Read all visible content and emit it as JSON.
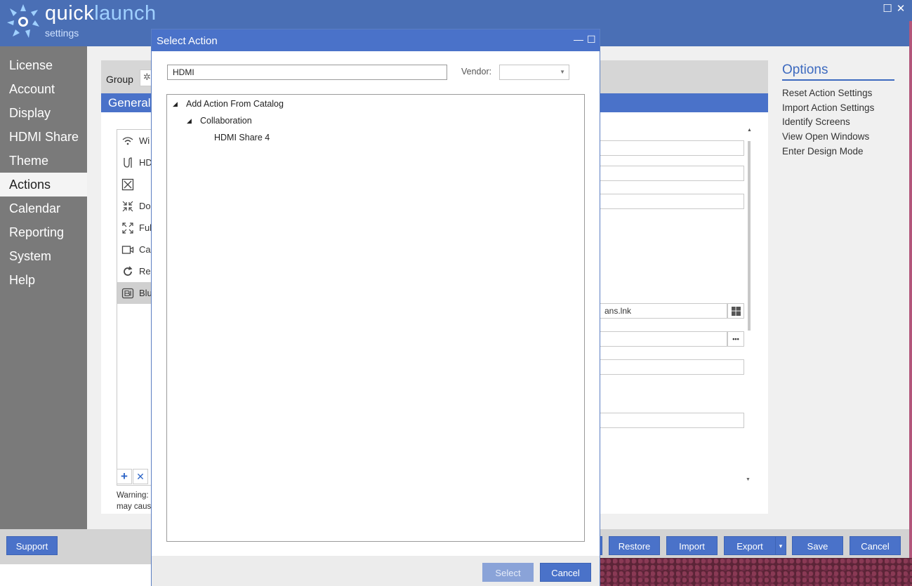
{
  "app": {
    "logo_quick": "quick",
    "logo_launch": "launch",
    "logo_settings": "settings",
    "maximize_glyph": "☐",
    "close_glyph": "✕"
  },
  "sidebar": {
    "items": [
      {
        "label": "License"
      },
      {
        "label": "Account"
      },
      {
        "label": "Display"
      },
      {
        "label": "HDMI Share"
      },
      {
        "label": "Theme"
      },
      {
        "label": "Actions",
        "active": true
      },
      {
        "label": "Calendar"
      },
      {
        "label": "Reporting"
      },
      {
        "label": "System"
      },
      {
        "label": "Help"
      }
    ]
  },
  "main": {
    "group_label": "Group",
    "general_label": "General",
    "actions": [
      {
        "icon": "wifi-icon",
        "label": "Wi"
      },
      {
        "icon": "hdmi-cable-icon",
        "label": "HD"
      },
      {
        "icon": "close-box-icon",
        "label": ""
      },
      {
        "icon": "collapse-arrows-icon",
        "label": "Do"
      },
      {
        "icon": "expand-arrows-icon",
        "label": "Ful"
      },
      {
        "icon": "camera-icon",
        "label": "Ca"
      },
      {
        "icon": "refresh-icon",
        "label": "Res"
      },
      {
        "icon": "bluejeans-icon",
        "label": "Blu",
        "selected": true
      }
    ],
    "add_glyph": "+",
    "remove_glyph": "✕",
    "warning_line1": "Warning:",
    "warning_line2": "may caus",
    "path_field_value": "ans.lnk",
    "browse_glyph": "•••"
  },
  "options": {
    "title": "Options",
    "items": [
      "Reset Action Settings",
      "Import Action Settings",
      "Identify Screens",
      "View Open Windows",
      "Enter Design Mode"
    ]
  },
  "bottom": {
    "support": "Support",
    "restore": "Restore",
    "import": "Import",
    "export": "Export",
    "export_arrow": "▾",
    "save": "Save",
    "cancel": "Cancel"
  },
  "dialog": {
    "title": "Select Action",
    "minimize_glyph": "—",
    "maximize_glyph": "☐",
    "search_value": "HDMI",
    "vendor_label": "Vendor:",
    "vendor_value": "",
    "tree": {
      "root": "Add Action From Catalog",
      "category": "Collaboration",
      "leaf": "HDMI Share 4"
    },
    "select_button": "Select",
    "cancel_button": "Cancel"
  },
  "colors": {
    "accent": "#4a72c9",
    "header": "#4a6fb5",
    "sidebar": "#7a7a7a"
  }
}
